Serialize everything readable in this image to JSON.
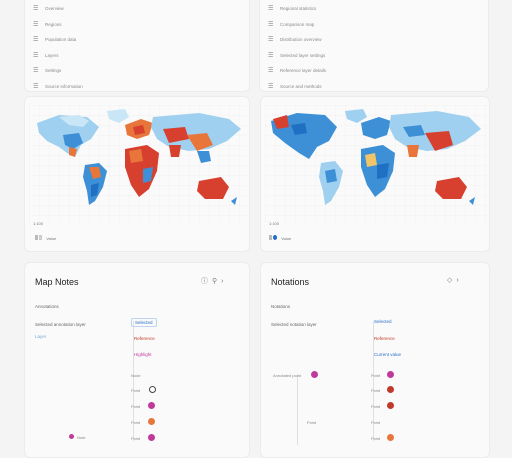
{
  "top_left": {
    "rows": [
      {
        "icon": "☰",
        "label": "Overview"
      },
      {
        "icon": "☰",
        "label": "Regions"
      },
      {
        "icon": "☰",
        "label": "Population data"
      },
      {
        "icon": "☰",
        "label": "Layers"
      },
      {
        "icon": "☰",
        "label": "Settings"
      },
      {
        "icon": "☰",
        "label": "Source information"
      }
    ]
  },
  "top_right": {
    "rows": [
      {
        "icon": "☰",
        "label": "Regional statistics"
      },
      {
        "icon": "☰",
        "label": "Comparison map"
      },
      {
        "icon": "☰",
        "label": "Distribution overview"
      },
      {
        "icon": "☰",
        "label": "Selected layer settings"
      },
      {
        "icon": "☰",
        "label": "Reference layer details"
      },
      {
        "icon": "☰",
        "label": "Source and methods"
      }
    ]
  },
  "map_left": {
    "scale_label": "1:100",
    "legend_text": "Value"
  },
  "map_right": {
    "scale_label": "1:100",
    "legend_text": "Value"
  },
  "notes_left": {
    "title": "Map Notes",
    "subtitle": "Annotations",
    "filter_label": "Selected annotation layer",
    "filter_sub": "Layer",
    "chips": [
      {
        "text": "Selected",
        "color": "#2a6fc9"
      },
      {
        "text": "Reference",
        "color": "#c0392b"
      },
      {
        "text": "Highlight",
        "color": "#c0399b"
      }
    ],
    "node_labels": [
      "Node",
      "Point",
      "Point",
      "Point",
      "Point",
      "Point"
    ],
    "bottom_label": "Note"
  },
  "notes_right": {
    "title": "Notations",
    "subtitle": "Notations",
    "filter_label": "Selected notation layer",
    "chips": [
      {
        "text": "Selected",
        "color": "#2a6fc9"
      },
      {
        "text": "Reference",
        "color": "#c0392b"
      },
      {
        "text": "Current value",
        "color": "#2a6fc9"
      }
    ],
    "node_labels": [
      "Point",
      "Point",
      "Point",
      "Point",
      "Point"
    ],
    "mid_label": "Annotated point",
    "low_label": "Point"
  }
}
